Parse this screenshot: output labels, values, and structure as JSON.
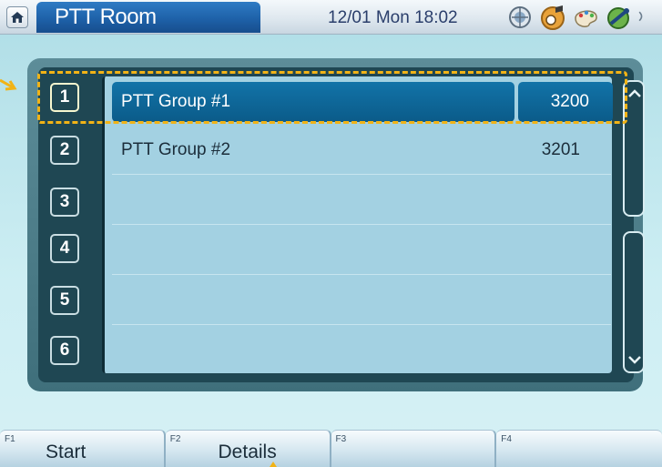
{
  "header": {
    "title": "PTT Room",
    "datetime": "12/01 Mon 18:02",
    "home_icon": "home-icon",
    "status_icons": [
      "globe-icon",
      "music-icon",
      "palette-icon",
      "satellite-icon",
      "antenna-icon"
    ]
  },
  "numbers": [
    "1",
    "2",
    "3",
    "4",
    "5",
    "6"
  ],
  "groups": [
    {
      "name": "PTT Group #1",
      "number": "3200",
      "selected": true
    },
    {
      "name": "PTT Group #2",
      "number": "3201",
      "selected": false
    }
  ],
  "function_keys": [
    {
      "key": "F1",
      "label": "Start"
    },
    {
      "key": "F2",
      "label": "Details"
    },
    {
      "key": "F3",
      "label": ""
    },
    {
      "key": "F4",
      "label": ""
    }
  ],
  "colors": {
    "accent": "#1d5fa6",
    "selection": "#0b5b89",
    "highlight": "#f2b316"
  }
}
